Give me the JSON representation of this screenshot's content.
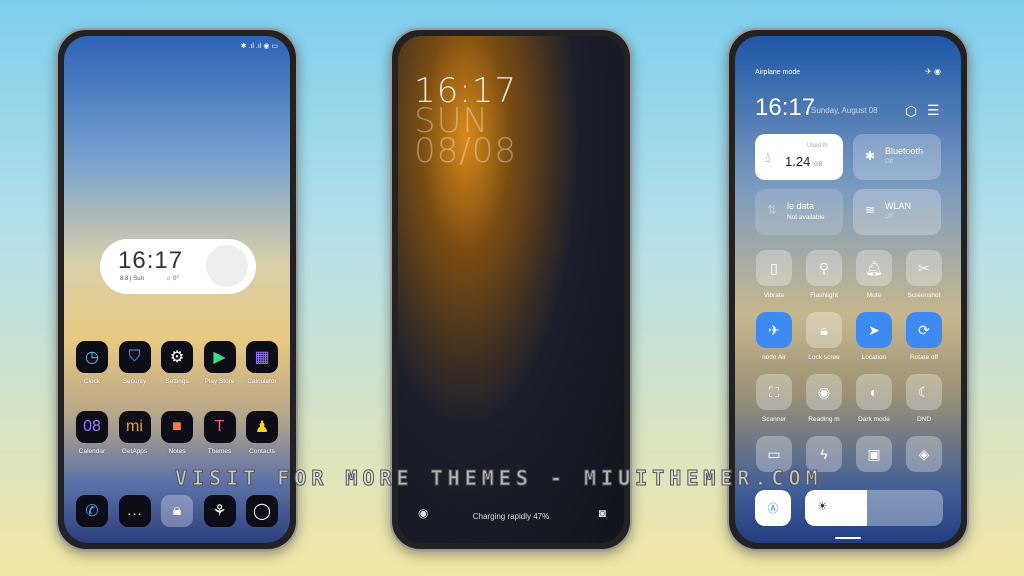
{
  "home": {
    "status": "✱ .ıl .ıl ◉ ▭",
    "widget": {
      "time": "16:17",
      "date": "8.8 | Sun",
      "weather": "☼ 0°"
    },
    "apps": [
      {
        "label": "Clock",
        "icon": "clock-icon",
        "glyph": "◷",
        "color": "#5fd0ff"
      },
      {
        "label": "Security",
        "icon": "shield-icon",
        "glyph": "⛉",
        "color": "#4aa8ff"
      },
      {
        "label": "Settings",
        "icon": "gear-icon",
        "glyph": "⚙",
        "color": "#ffffff"
      },
      {
        "label": "Play Store",
        "icon": "play-store-icon",
        "glyph": "▶",
        "color": "#3ddc84"
      },
      {
        "label": "Calculator",
        "icon": "calculator-icon",
        "glyph": "▦",
        "color": "#9b7bff"
      },
      {
        "label": "Calendar",
        "icon": "calendar-icon",
        "glyph": "08",
        "color": "#9b7bff"
      },
      {
        "label": "GetApps",
        "icon": "mi-icon",
        "glyph": "mi",
        "color": "#f0a020"
      },
      {
        "label": "Notes",
        "icon": "notes-icon",
        "glyph": "■",
        "color": "#ff7a45"
      },
      {
        "label": "Themes",
        "icon": "themes-icon",
        "glyph": "T",
        "color": "#ff5a6a"
      },
      {
        "label": "Contacts",
        "icon": "contacts-icon",
        "glyph": "♟",
        "color": "#ffd21f"
      }
    ],
    "dock": [
      {
        "icon": "phone-icon",
        "glyph": "✆",
        "color": "#4aa8ff"
      },
      {
        "icon": "messages-icon",
        "glyph": "…",
        "color": "#f3b8a0"
      },
      {
        "icon": "lock-icon",
        "glyph": "🔒︎",
        "color": "#ffffff"
      },
      {
        "icon": "gallery-icon",
        "glyph": "⚘",
        "color": "#ffffff"
      },
      {
        "icon": "camera-icon",
        "glyph": "◯",
        "color": "#ffffff"
      }
    ]
  },
  "lock": {
    "time": "16:17",
    "day": "SUN",
    "date": "08/08",
    "charging": "Charging rapidly 47%"
  },
  "control": {
    "status_left": "Airplane mode",
    "status_right": "✈ ◉",
    "time": "16:17",
    "date": "Sunday, August 08",
    "data_card": {
      "title": "Used th",
      "value": "1.24",
      "unit": "GB"
    },
    "bluetooth": {
      "title": "Bluetooth",
      "state": "Off"
    },
    "mobile": {
      "title": "le data",
      "state": "Not available"
    },
    "wlan": {
      "title": "WLAN",
      "state": "Off"
    },
    "tiles": [
      {
        "label": "Vibrate",
        "glyph": "▯",
        "on": false
      },
      {
        "label": "Flashlight",
        "glyph": "⚲",
        "on": false
      },
      {
        "label": "Mute",
        "glyph": "🔔︎",
        "on": false
      },
      {
        "label": "Screenshot",
        "glyph": "✂",
        "on": false
      },
      {
        "label": "node    Air",
        "glyph": "✈",
        "on": true
      },
      {
        "label": "Lock scree",
        "glyph": "🔒︎",
        "on": false
      },
      {
        "label": "Location",
        "glyph": "➤",
        "on": true
      },
      {
        "label": "Rotate off",
        "glyph": "⟳",
        "on": true
      },
      {
        "label": "Scanner",
        "glyph": "⛶",
        "on": false
      },
      {
        "label": "Reading m",
        "glyph": "◉",
        "on": false
      },
      {
        "label": "Dark mode",
        "glyph": "◐",
        "on": false
      },
      {
        "label": "DND",
        "glyph": "☾",
        "on": false
      },
      {
        "label": "",
        "glyph": "▭",
        "on": false
      },
      {
        "label": "",
        "glyph": "ϟ",
        "on": false
      },
      {
        "label": "",
        "glyph": "▣",
        "on": false
      },
      {
        "label": "",
        "glyph": "◈",
        "on": false
      }
    ],
    "brightness": 0.45
  },
  "watermark": "VISIT FOR MORE THEMES - MIUITHEMER.COM"
}
